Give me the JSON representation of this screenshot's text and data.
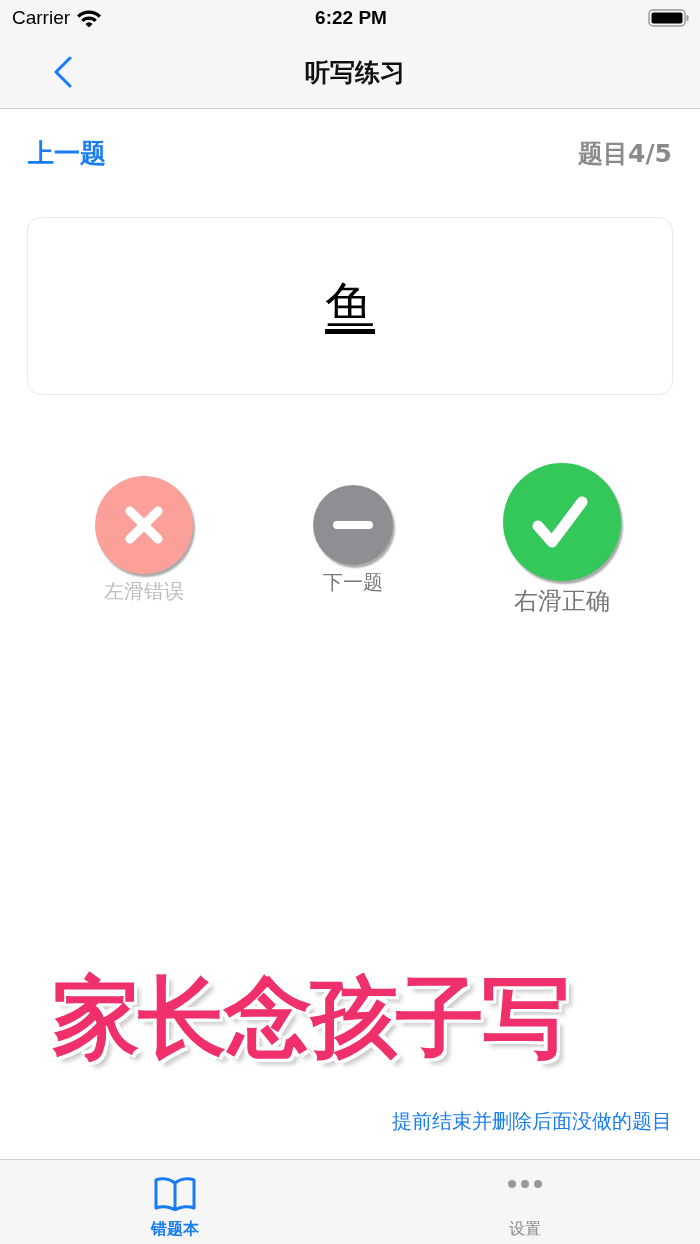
{
  "status_bar": {
    "carrier": "Carrier",
    "time": "6:22 PM"
  },
  "nav": {
    "title": "听写练习"
  },
  "header": {
    "prev": "上一题",
    "progress": "题目4/5"
  },
  "card": {
    "word": "鱼"
  },
  "actions": [
    {
      "kind": "wrong",
      "label": "左滑错误"
    },
    {
      "kind": "skip",
      "label": "下一题"
    },
    {
      "kind": "correct",
      "label": "右滑正确"
    }
  ],
  "banner": "家长念孩子写",
  "end_link": "提前结束并删除后面没做的题目",
  "tabs": [
    {
      "kind": "book",
      "label": "错题本",
      "selected": true
    },
    {
      "kind": "more",
      "label": "设置",
      "selected": false
    }
  ]
}
